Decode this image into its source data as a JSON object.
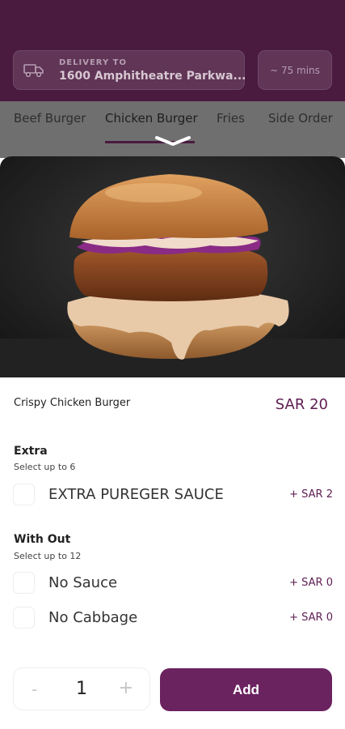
{
  "header": {
    "delivery_caption": "DELIVERY TO",
    "delivery_address": "1600 Amphitheatre Parkwa...",
    "eta": "~ 75 mins",
    "delivery_icon": "truck-icon"
  },
  "tabs": [
    {
      "label": "Beef Burger",
      "active": false
    },
    {
      "label": "Chicken Burger",
      "active": true
    },
    {
      "label": "Fries",
      "active": false
    },
    {
      "label": "Side Order",
      "active": false
    }
  ],
  "sheet": {
    "handle_icon": "chevron-down-icon",
    "item": {
      "name": "Crispy Chicken Burger",
      "price": "SAR 20"
    },
    "sections": [
      {
        "title": "Extra",
        "subtitle": "Select up to 6",
        "options": [
          {
            "label": "EXTRA PUREGER SAUCE",
            "price": "+  SAR 2",
            "checked": false
          }
        ]
      },
      {
        "title": "With Out",
        "subtitle": "Select up to 12",
        "options": [
          {
            "label": "No Sauce",
            "price": "+  SAR 0",
            "checked": false
          },
          {
            "label": "No Cabbage",
            "price": "+  SAR 0",
            "checked": false
          }
        ]
      }
    ],
    "quantity": {
      "minus": "-",
      "value": "1",
      "plus": "+"
    },
    "add_label": "Add"
  },
  "colors": {
    "brand": "#6b2360",
    "header_bg": "#4a1a3f",
    "price": "#5e1d52"
  }
}
